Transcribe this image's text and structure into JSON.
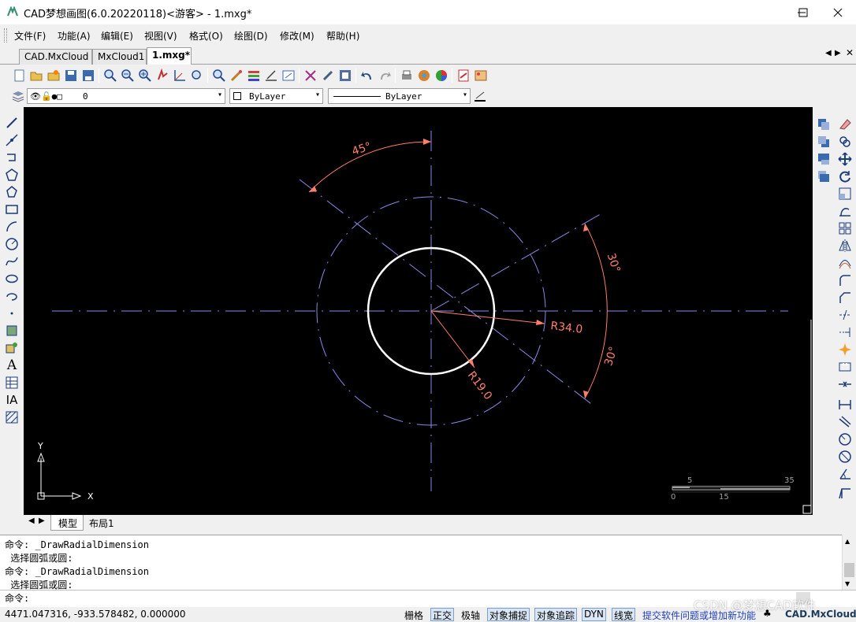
{
  "window": {
    "title": "CAD梦想画图(6.0.20220118)<游客> - 1.mxg*",
    "minimize_icon": "minimize-icon",
    "maximize_icon": "maximize-icon",
    "close_icon": "close-icon"
  },
  "menu": [
    "文件(F)",
    "功能(A)",
    "编辑(E)",
    "视图(V)",
    "格式(O)",
    "绘图(D)",
    "修改(M)",
    "帮助(H)"
  ],
  "doc_tabs": [
    "CAD.MxCloud",
    "MxCloud1",
    "1.mxg*"
  ],
  "layer_bar": {
    "layer_value": "0",
    "color_value": "ByLayer",
    "linetype_value": "ByLayer"
  },
  "drawing": {
    "angle_top": "45°",
    "angle_right_upper": "30°",
    "angle_right_lower": "30°",
    "radius_outer": "R34.0",
    "radius_inner": "R19.0",
    "ucs_y": "Y",
    "ucs_x": "X",
    "scale_top_left": "5",
    "scale_top_right": "35",
    "scale_bottom_left": "0",
    "scale_bottom_mid": "15",
    "colors": {
      "background": "#000000",
      "dimension": "#ff7f6a",
      "centerline": "#8a8ae6",
      "circle_inner": "#ffffff"
    }
  },
  "layout_tabs": [
    "模型",
    "布局1"
  ],
  "command_history": [
    "命令: _DrawRadialDimension",
    " 选择圆弧或圆:",
    "命令: _DrawRadialDimension",
    " 选择圆弧或圆:"
  ],
  "command_prompt": "命令:",
  "status": {
    "coords": "4471.047316,  -933.578482,  0.000000",
    "buttons": [
      {
        "label": "栅格",
        "on": false
      },
      {
        "label": "正交",
        "on": true
      },
      {
        "label": "极轴",
        "on": false
      },
      {
        "label": "对象捕捉",
        "on": true
      },
      {
        "label": "对象追踪",
        "on": true
      },
      {
        "label": "DYN",
        "on": true
      },
      {
        "label": "线宽",
        "on": true
      }
    ],
    "link": "提交软件问题或增加新功能",
    "brand": "CAD.MxCloud",
    "watermark": "CSDN @梦想CAD软件"
  }
}
